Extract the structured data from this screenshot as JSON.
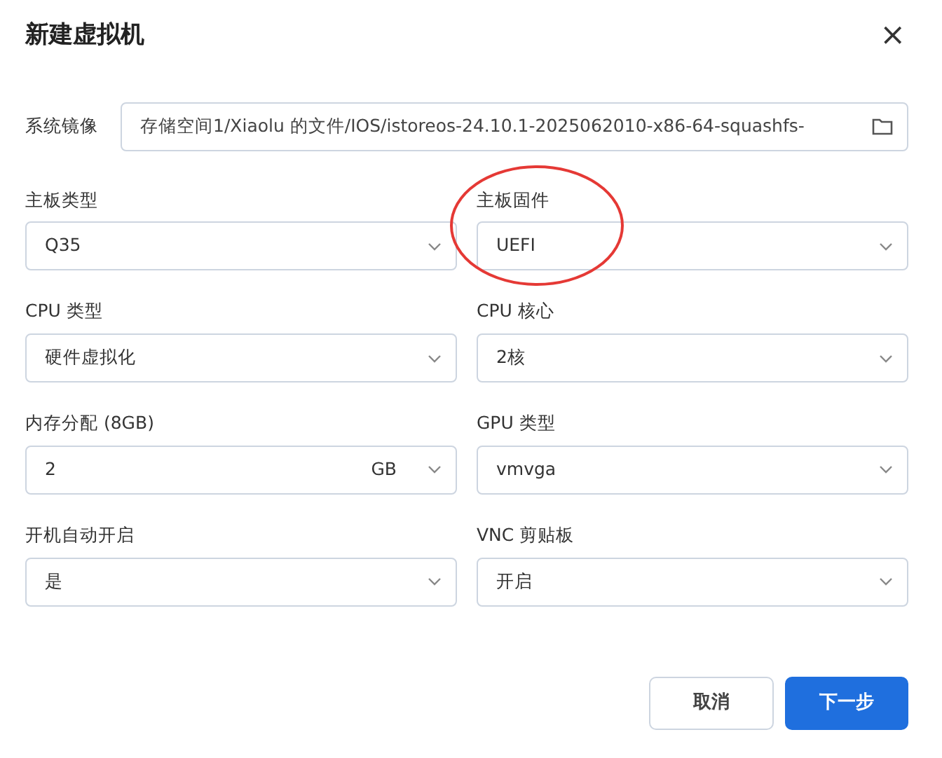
{
  "dialog": {
    "title": "新建虚拟机",
    "close": "×"
  },
  "image": {
    "label": "系统镜像",
    "value": "存储空间1/Xiaolu 的文件/IOS/istoreos-24.10.1-2025062010-x86-64-squashfs-"
  },
  "fields": [
    {
      "label": "主板类型",
      "value": "Q35",
      "annotated": false
    },
    {
      "label": "主板固件",
      "value": "UEFI",
      "annotated": true
    },
    {
      "label": "CPU 类型",
      "value": "硬件虚拟化",
      "annotated": false
    },
    {
      "label": "CPU 核心",
      "value": "2核",
      "annotated": false
    },
    {
      "label": "内存分配 (8GB)",
      "value": "2",
      "unit": "GB",
      "annotated": false
    },
    {
      "label": "GPU 类型",
      "value": "vmvga",
      "annotated": false
    },
    {
      "label": "开机自动开启",
      "value": "是",
      "annotated": false
    },
    {
      "label": "VNC 剪贴板",
      "value": "开启",
      "annotated": false
    }
  ],
  "buttons": [
    {
      "label": "取消",
      "kind": "secondary"
    },
    {
      "label": "下一步",
      "kind": "primary"
    }
  ]
}
